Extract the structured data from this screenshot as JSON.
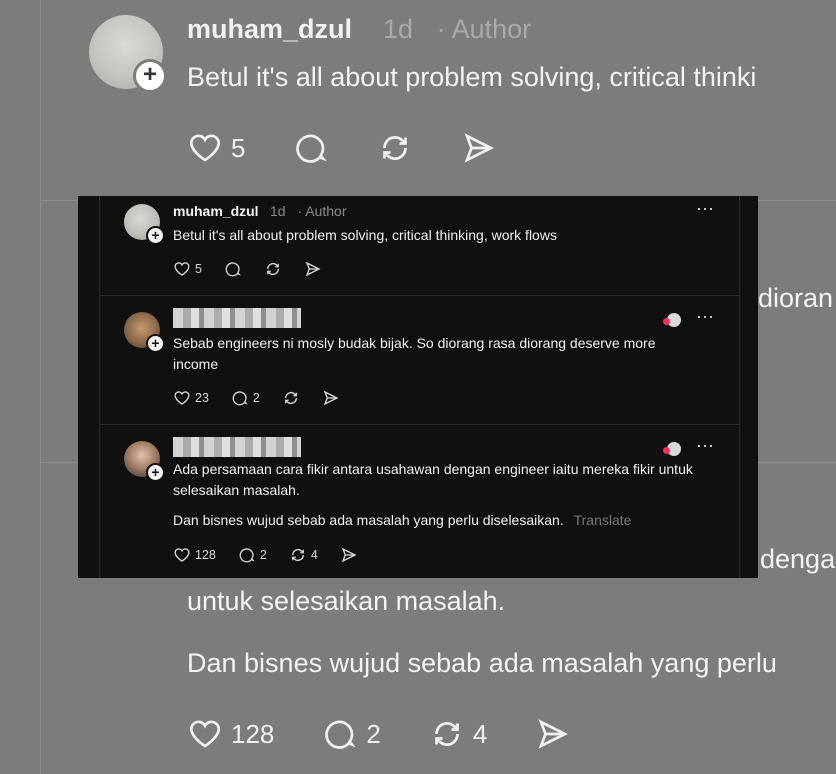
{
  "background": {
    "username": "muham_dzul",
    "time": "1d",
    "author_label": "· Author",
    "reply_text": "Betul it's all about problem solving, critical thinki",
    "like_count": "5",
    "partial_right_1": "dioran",
    "partial_right_2": "denga",
    "line_1": "untuk selesaikan masalah.",
    "line_2": "Dan bisnes wujud sebab ada masalah yang perlu",
    "like_count_2": "128",
    "reply_count_2": "2",
    "repost_count_2": "4"
  },
  "posts": [
    {
      "username": "muham_dzul",
      "time": "1d",
      "author_label": "· Author",
      "text": "Betul it's all about problem solving, critical thinking, work flows",
      "likes": "5",
      "replies": "",
      "reposts": ""
    },
    {
      "username": "",
      "text": "Sebab engineers ni mosly budak bijak. So diorang rasa diorang deserve more income",
      "likes": "23",
      "replies": "2",
      "reposts": ""
    },
    {
      "username": "",
      "text": "Ada persamaan cara fikir antara usahawan dengan engineer iaitu mereka fikir untuk selesaikan masalah.",
      "text2": "Dan bisnes wujud sebab ada masalah yang perlu diselesaikan.",
      "translate": "Translate",
      "likes": "128",
      "replies": "2",
      "reposts": "4"
    }
  ],
  "more_icon": "⋯",
  "colors": {
    "panel_bg": "#101010",
    "page_bg": "#7c7c7c",
    "muted": "#8a8a8a"
  }
}
